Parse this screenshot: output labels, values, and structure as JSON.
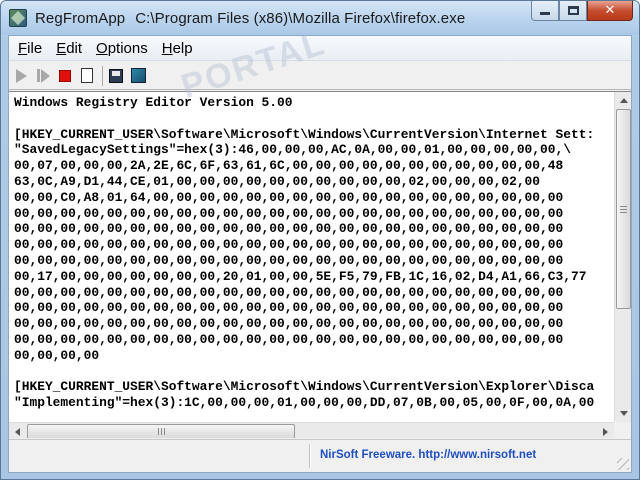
{
  "window": {
    "app_name": "RegFromApp",
    "process_path": "C:\\Program Files (x86)\\Mozilla Firefox\\firefox.exe",
    "close_glyph": "✕"
  },
  "menu": {
    "items": [
      {
        "accel": "F",
        "rest": "ile"
      },
      {
        "accel": "E",
        "rest": "dit"
      },
      {
        "accel": "O",
        "rest": "ptions"
      },
      {
        "accel": "H",
        "rest": "elp"
      }
    ]
  },
  "watermark": {
    "text": "PORTAL"
  },
  "editor": {
    "lines": [
      "Windows Registry Editor Version 5.00",
      "",
      "[HKEY_CURRENT_USER\\Software\\Microsoft\\Windows\\CurrentVersion\\Internet Sett:",
      "\"SavedLegacySettings\"=hex(3):46,00,00,00,AC,0A,00,00,01,00,00,00,00,00,\\",
      "00,07,00,00,00,2A,2E,6C,6F,63,61,6C,00,00,00,00,00,00,00,00,00,00,00,48",
      "63,0C,A9,D1,44,CE,01,00,00,00,00,00,00,00,00,00,00,02,00,00,00,02,00",
      "00,00,C0,A8,01,64,00,00,00,00,00,00,00,00,00,00,00,00,00,00,00,00,00,00",
      "00,00,00,00,00,00,00,00,00,00,00,00,00,00,00,00,00,00,00,00,00,00,00,00",
      "00,00,00,00,00,00,00,00,00,00,00,00,00,00,00,00,00,00,00,00,00,00,00,00",
      "00,00,00,00,00,00,00,00,00,00,00,00,00,00,00,00,00,00,00,00,00,00,00,00",
      "00,00,00,00,00,00,00,00,00,00,00,00,00,00,00,00,00,00,00,00,00,00,00,00",
      "00,17,00,00,00,00,00,00,00,20,01,00,00,5E,F5,79,FB,1C,16,02,D4,A1,66,C3,77",
      "00,00,00,00,00,00,00,00,00,00,00,00,00,00,00,00,00,00,00,00,00,00,00,00",
      "00,00,00,00,00,00,00,00,00,00,00,00,00,00,00,00,00,00,00,00,00,00,00,00",
      "00,00,00,00,00,00,00,00,00,00,00,00,00,00,00,00,00,00,00,00,00,00,00,00",
      "00,00,00,00,00,00,00,00,00,00,00,00,00,00,00,00,00,00,00,00,00,00,00,00",
      "00,00,00,00",
      "",
      "[HKEY_CURRENT_USER\\Software\\Microsoft\\Windows\\CurrentVersion\\Explorer\\Disca",
      "\"Implementing\"=hex(3):1C,00,00,00,01,00,00,00,DD,07,0B,00,05,00,0F,00,0A,00"
    ]
  },
  "status": {
    "link_text": "NirSoft Freeware.  http://www.nirsoft.net"
  }
}
